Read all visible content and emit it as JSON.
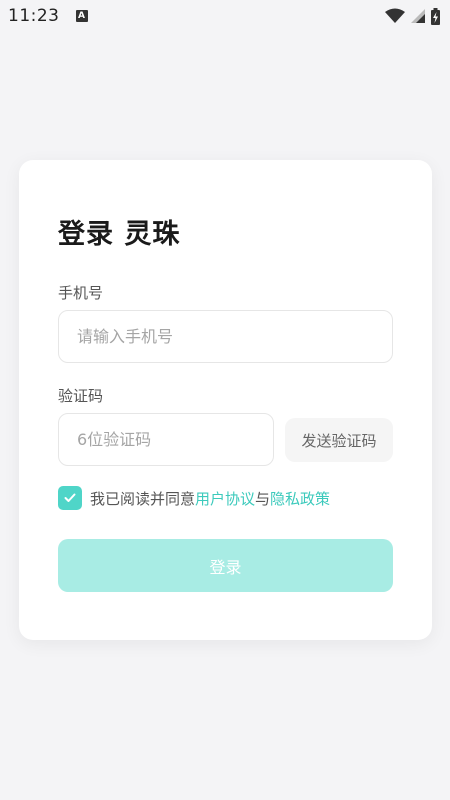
{
  "status_bar": {
    "time": "11:23",
    "notification_icon_letter": "A",
    "icons": [
      "wifi-icon",
      "signal-icon",
      "battery-charging-icon"
    ]
  },
  "login": {
    "title": "登录 灵珠",
    "phone": {
      "label": "手机号",
      "placeholder": "请输入手机号",
      "value": ""
    },
    "code": {
      "label": "验证码",
      "placeholder": "6位验证码",
      "value": "",
      "send_button_label": "发送验证码"
    },
    "agreement": {
      "checked": true,
      "prefix": "我已阅读并同意",
      "terms_link": "用户协议",
      "connector": "与",
      "privacy_link": "隐私政策"
    },
    "submit_label": "登录"
  },
  "colors": {
    "accent": "#4fd5c8",
    "link": "#3ccabc",
    "button_disabled": "#a8ece4",
    "background": "#f4f4f6"
  }
}
